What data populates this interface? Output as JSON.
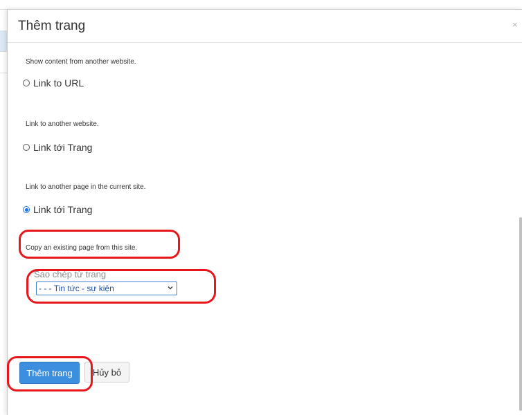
{
  "dialog": {
    "title": "Thêm trang",
    "close_glyph": "×"
  },
  "options": [
    {
      "description": "Show content from another website.",
      "label": "Link to URL",
      "selected": false
    },
    {
      "description": "Link to another website.",
      "label": "Link tới Trang",
      "selected": false
    },
    {
      "description": "Link to another page in the current site.",
      "label": "Link tới Trang",
      "selected": true
    }
  ],
  "copy_section": {
    "description": "Copy an existing page from this site.",
    "label": "Sao chép từ trang",
    "selected_value": "- - - Tin tức - sự kiện"
  },
  "buttons": {
    "primary_label": "Thêm trang",
    "cancel_label": "Hủy bỏ"
  },
  "colors": {
    "primary_button": "#3c8ede",
    "annotation_red": "#e8161b",
    "radio_checked": "#1a73e8"
  }
}
